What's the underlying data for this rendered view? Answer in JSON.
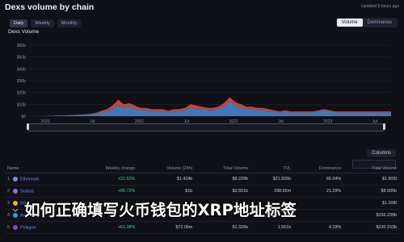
{
  "header": {
    "title": "Dexs volume by chain",
    "updated": "Updated 6 hours ago"
  },
  "tabs": [
    {
      "label": "Daily",
      "active": true
    },
    {
      "label": "Weekly",
      "active": false
    },
    {
      "label": "Monthly",
      "active": false
    }
  ],
  "toggle": [
    {
      "label": "Volume",
      "active": true
    },
    {
      "label": "Dominance",
      "active": false
    }
  ],
  "chart_data": {
    "type": "area",
    "title": "Dexs Volume",
    "xlabel": "",
    "ylabel": "",
    "x_ticks": [
      "2020",
      "Jul",
      "2021",
      "Jul",
      "2022",
      "Jul",
      "2023",
      "Jul"
    ],
    "y_ticks": [
      "$60b",
      "$50b",
      "$40b",
      "$30b",
      "$20b",
      "$10b",
      "$0"
    ],
    "ylim": [
      0,
      60
    ],
    "grid": true,
    "legend": "none",
    "series": [
      {
        "color": "#4a8bd8",
        "values": [
          0.1,
          0.1,
          0.1,
          0.2,
          0.3,
          0.5,
          0.6,
          0.7,
          0.8,
          1.0,
          1.2,
          1.5,
          2,
          3,
          4,
          6,
          9,
          7,
          8,
          6,
          5,
          5,
          4,
          4,
          4,
          3,
          4,
          4,
          5,
          7,
          6,
          6,
          5,
          5,
          6,
          8,
          12,
          9,
          7,
          6,
          6,
          5,
          5,
          4,
          4,
          3,
          4,
          3,
          3,
          3,
          3,
          3,
          4,
          5,
          4,
          3,
          3,
          3,
          3,
          3,
          3,
          3,
          3,
          3,
          3,
          3
        ]
      },
      {
        "color": "#e0523f",
        "values": [
          0,
          0,
          0,
          0,
          0,
          0.1,
          0.1,
          0.1,
          0.2,
          0.3,
          0.4,
          0.5,
          0.8,
          1.5,
          2,
          3,
          5,
          3,
          3,
          3,
          2,
          2,
          2,
          2,
          2,
          1.5,
          2,
          2,
          2,
          3,
          3,
          2,
          2,
          2,
          2,
          3,
          4,
          3,
          3,
          2,
          2,
          2,
          2,
          2,
          1,
          1,
          1,
          1,
          1,
          1,
          1,
          1,
          1,
          1,
          1,
          1,
          1,
          1,
          1,
          1,
          1,
          1,
          1,
          1,
          1,
          1
        ]
      }
    ]
  },
  "controls": {
    "columns_button": "Columns"
  },
  "table": {
    "headers": [
      "Name",
      "Weekly change",
      "Volume (24h)",
      "Total Volume",
      "TVL",
      "Dominance",
      "Total Volume"
    ],
    "rows": [
      {
        "rank": "1",
        "name": "Ethereum",
        "color": "#7a8be3",
        "cols": [
          "+21.62%",
          "$1.434b",
          "$9.229b",
          "$21.926b",
          "65.04%",
          "$1.905t"
        ]
      },
      {
        "rank": "2",
        "name": "Solana",
        "color": "#9b6bf0",
        "cols": [
          "+65.72%",
          "$1b",
          "$3.551b",
          "298.65m",
          "21.29%",
          "$8.905b"
        ]
      },
      {
        "rank": "3",
        "name": "BSC",
        "color": "#f0b90b",
        "cols": [
          "",
          "",
          "",
          "",
          "",
          "$1.208t"
        ]
      },
      {
        "rank": "4",
        "name": "Arbitrum",
        "color": "#2d9cdb",
        "cols": [
          "",
          "",
          "",
          "",
          "",
          "$156.238b"
        ]
      },
      {
        "rank": "5",
        "name": "Polygon",
        "color": "#8247e5",
        "cols": [
          "+61.38%",
          "$72.06m",
          "$1.326b",
          "1.561b",
          "4.19%",
          "$230.153b"
        ]
      }
    ]
  },
  "overlay": {
    "text": "如何正确填写火币钱包的XRP地址标签"
  }
}
